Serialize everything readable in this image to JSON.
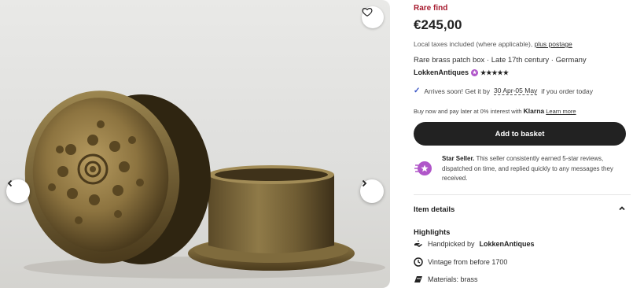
{
  "gallery": {
    "image_alt": "Rare brass patch box",
    "favorite_icon": "heart-outline-icon",
    "prev_icon": "chevron-left-icon",
    "next_icon": "chevron-right-icon"
  },
  "listing": {
    "tag": "Rare find",
    "price": "€245,00",
    "taxes_text": "Local taxes included (where applicable),",
    "postage_link": "plus postage",
    "title": "Rare brass patch box · Late 17th century · Germany",
    "shop_name": "LokkenAntiques",
    "rating_stars": "★★★★★",
    "shipping_prefix": "Arrives soon! Get it by",
    "shipping_dates": "30 Apr-05 May",
    "shipping_suffix": "if you order today",
    "klarna_text": "Buy now and pay later at 0% interest with",
    "klarna_brand": "Klarna",
    "klarna_link": "Learn more",
    "cart_button": "Add to basket",
    "star_seller_label": "Star Seller.",
    "star_seller_text": "This seller consistently earned 5-star reviews, dispatched on time, and replied quickly to any messages they received.",
    "item_details_label": "Item details",
    "highlights_title": "Highlights",
    "highlights": [
      {
        "icon": "hand-icon",
        "prefix": "Handpicked by",
        "bold": "LokkenAntiques"
      },
      {
        "icon": "clock-icon",
        "prefix": "Vintage from before 1700",
        "bold": ""
      },
      {
        "icon": "materials-icon",
        "prefix": "Materials: brass",
        "bold": ""
      }
    ]
  },
  "colors": {
    "accent_red": "#a61a2e",
    "button_dark": "#222222",
    "star_seller_purple": "#b056c9",
    "check_blue": "#3a55c6"
  }
}
